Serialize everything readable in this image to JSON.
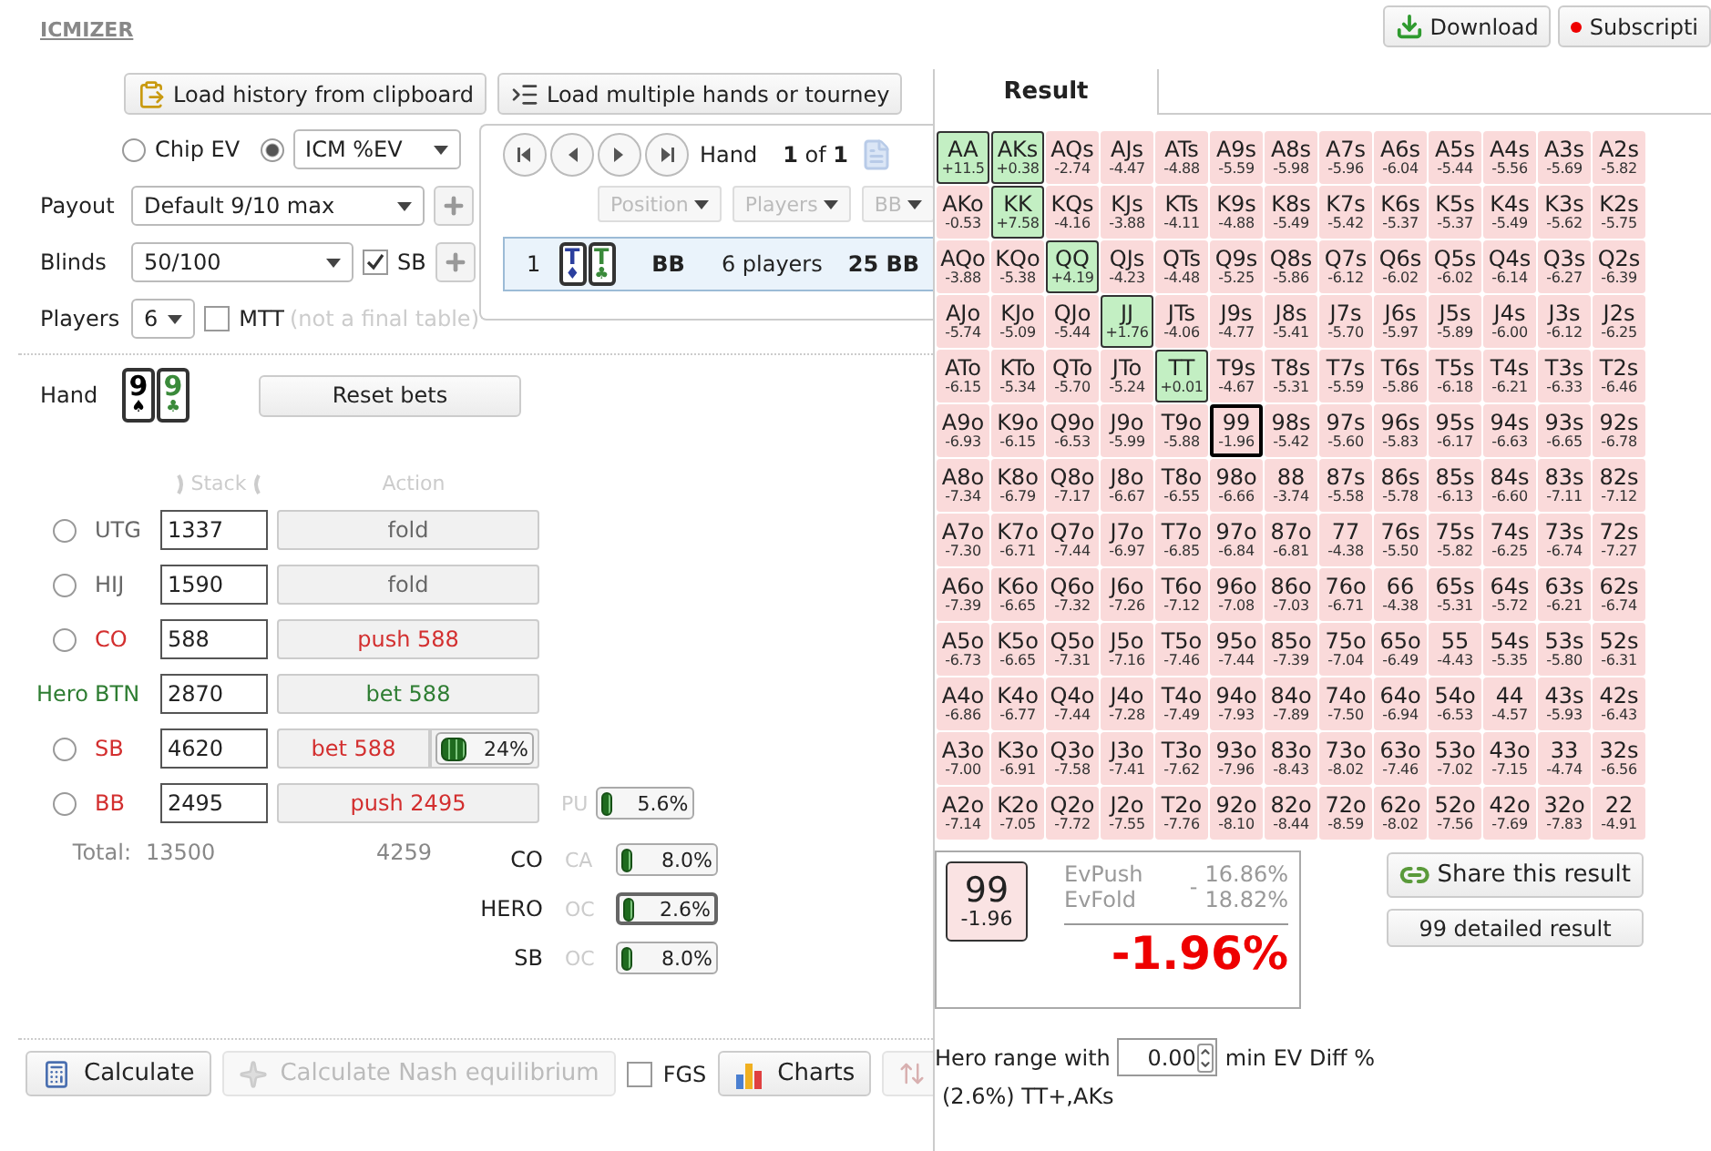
{
  "brand": "ICMIZER",
  "top_buttons": [
    {
      "label": "Download",
      "kind": "download"
    },
    {
      "label": "Subscripti",
      "kind": "subscription"
    }
  ],
  "load_buttons": [
    {
      "label": "Load history from clipboard",
      "kind": "clipboard"
    },
    {
      "label": "Load multiple hands or tourney",
      "kind": "list"
    }
  ],
  "mode": [
    {
      "label": "Chip EV",
      "selected": false,
      "kind": "plain"
    },
    {
      "label": "ICM %EV",
      "selected": true,
      "kind": "dropdown"
    }
  ],
  "payout": {
    "label": "Payout",
    "value": "Default 9/10 max"
  },
  "blinds": {
    "label": "Blinds",
    "value": "50/100",
    "checkbox": {
      "label": "SB",
      "checked": true
    }
  },
  "players": {
    "label": "Players",
    "value": "6",
    "checkbox": {
      "label": "MTT",
      "checked": false
    },
    "note": "(not a final table)"
  },
  "history": {
    "hand_label": "Hand",
    "counter": "**1** of **1**",
    "filters": [
      {
        "label": "Position",
        "disabled": true
      },
      {
        "label": "Players",
        "disabled": true
      },
      {
        "label": "BB",
        "disabled": true
      }
    ],
    "hands": [
      {
        "number": "1",
        "cards": [
          {
            "rank": "T",
            "suit": "♦",
            "color": "#2b3f9e"
          },
          {
            "rank": "T",
            "suit": "♣",
            "color": "#3a8a3a"
          }
        ],
        "position": "BB",
        "players": "6 players",
        "stack": "25 BB",
        "selected": true
      }
    ]
  },
  "hand": {
    "label": "Hand",
    "cards": [
      {
        "rank": "9",
        "suit": "♠",
        "color": "#000000"
      },
      {
        "rank": "9",
        "suit": "♣",
        "color": "#3a8a3a"
      }
    ],
    "reset_button": "Reset bets"
  },
  "table": {
    "columns": [
      "Stack",
      "Action"
    ],
    "rows": [
      {
        "kind": "villain",
        "position": "UTG",
        "selected": false,
        "color": "#666666",
        "stack": "1337",
        "action": "fold"
      },
      {
        "kind": "villain",
        "position": "HIJ",
        "selected": false,
        "color": "#666666",
        "stack": "1590",
        "action": "fold"
      },
      {
        "kind": "villain",
        "position": "CO",
        "selected": false,
        "color": "#d32f2f",
        "stack": "588",
        "action": "push 588"
      },
      {
        "kind": "hero",
        "hero_label": "Hero",
        "position": "BTN",
        "color": "#2e7d32",
        "stack": "2870",
        "action": "bet 588"
      },
      {
        "kind": "villain",
        "position": "SB",
        "selected": false,
        "color": "#d32f2f",
        "stack": "4620",
        "action": "bet 588",
        "share": {
          "text": "24%",
          "level": 0.24
        }
      },
      {
        "kind": "villain",
        "position": "BB",
        "selected": false,
        "color": "#d32f2f",
        "stack": "2495",
        "action": "push 2495",
        "range": {
          "code": "PU",
          "text": "5.6%",
          "level": 0.056
        }
      }
    ],
    "total": {
      "label": "Total:",
      "stack": "13500",
      "action": "4259"
    }
  },
  "ranges": [
    {
      "position": "CO",
      "code": "CA",
      "text": "8.0%",
      "level": 0.08,
      "selected": false
    },
    {
      "position": "HERO",
      "code": "OC",
      "text": "2.6%",
      "level": 0.026,
      "selected": true
    },
    {
      "position": "SB",
      "code": "OC",
      "text": "8.0%",
      "level": 0.08,
      "selected": false
    }
  ],
  "bottom_buttons": [
    {
      "kind": "calculator",
      "label": "Calculate",
      "disabled": false
    },
    {
      "kind": "nash",
      "label": "Calculate Nash equilibrium",
      "disabled": true
    },
    {
      "kind": "checkbox",
      "label": "FGS",
      "checked": false
    },
    {
      "kind": "charts",
      "label": "Charts",
      "disabled": false
    },
    {
      "kind": "sort",
      "disabled": true
    }
  ],
  "result": {
    "tabs": [
      {
        "label": "Result",
        "selected": true
      }
    ],
    "grid": {
      "rows": [
        [
          {
            "hand": "AA",
            "ev": "+11.5",
            "in_range": true,
            "selected": false
          },
          {
            "hand": "AKs",
            "ev": "+0.38",
            "in_range": true,
            "selected": false
          },
          {
            "hand": "AQs",
            "ev": "-2.74",
            "in_range": false,
            "selected": false
          },
          {
            "hand": "AJs",
            "ev": "-4.47",
            "in_range": false,
            "selected": false
          },
          {
            "hand": "ATs",
            "ev": "-4.88",
            "in_range": false,
            "selected": false
          },
          {
            "hand": "A9s",
            "ev": "-5.59",
            "in_range": false,
            "selected": false
          },
          {
            "hand": "A8s",
            "ev": "-5.98",
            "in_range": false,
            "selected": false
          },
          {
            "hand": "A7s",
            "ev": "-5.96",
            "in_range": false,
            "selected": false
          },
          {
            "hand": "A6s",
            "ev": "-6.04",
            "in_range": false,
            "selected": false
          },
          {
            "hand": "A5s",
            "ev": "-5.44",
            "in_range": false,
            "selected": false
          },
          {
            "hand": "A4s",
            "ev": "-5.56",
            "in_range": false,
            "selected": false
          },
          {
            "hand": "A3s",
            "ev": "-5.69",
            "in_range": false,
            "selected": false
          },
          {
            "hand": "A2s",
            "ev": "-5.82",
            "in_range": false,
            "selected": false
          }
        ],
        [
          {
            "hand": "AKo",
            "ev": "-0.53",
            "in_range": false,
            "selected": false
          },
          {
            "hand": "KK",
            "ev": "+7.58",
            "in_range": true,
            "selected": false
          },
          {
            "hand": "KQs",
            "ev": "-4.16",
            "in_range": false,
            "selected": false
          },
          {
            "hand": "KJs",
            "ev": "-3.88",
            "in_range": false,
            "selected": false
          },
          {
            "hand": "KTs",
            "ev": "-4.11",
            "in_range": false,
            "selected": false
          },
          {
            "hand": "K9s",
            "ev": "-4.88",
            "in_range": false,
            "selected": false
          },
          {
            "hand": "K8s",
            "ev": "-5.49",
            "in_range": false,
            "selected": false
          },
          {
            "hand": "K7s",
            "ev": "-5.42",
            "in_range": false,
            "selected": false
          },
          {
            "hand": "K6s",
            "ev": "-5.37",
            "in_range": false,
            "selected": false
          },
          {
            "hand": "K5s",
            "ev": "-5.37",
            "in_range": false,
            "selected": false
          },
          {
            "hand": "K4s",
            "ev": "-5.49",
            "in_range": false,
            "selected": false
          },
          {
            "hand": "K3s",
            "ev": "-5.62",
            "in_range": false,
            "selected": false
          },
          {
            "hand": "K2s",
            "ev": "-5.75",
            "in_range": false,
            "selected": false
          }
        ],
        [
          {
            "hand": "AQo",
            "ev": "-3.88",
            "in_range": false,
            "selected": false
          },
          {
            "hand": "KQo",
            "ev": "-5.38",
            "in_range": false,
            "selected": false
          },
          {
            "hand": "QQ",
            "ev": "+4.19",
            "in_range": true,
            "selected": false
          },
          {
            "hand": "QJs",
            "ev": "-4.23",
            "in_range": false,
            "selected": false
          },
          {
            "hand": "QTs",
            "ev": "-4.48",
            "in_range": false,
            "selected": false
          },
          {
            "hand": "Q9s",
            "ev": "-5.25",
            "in_range": false,
            "selected": false
          },
          {
            "hand": "Q8s",
            "ev": "-5.86",
            "in_range": false,
            "selected": false
          },
          {
            "hand": "Q7s",
            "ev": "-6.12",
            "in_range": false,
            "selected": false
          },
          {
            "hand": "Q6s",
            "ev": "-6.02",
            "in_range": false,
            "selected": false
          },
          {
            "hand": "Q5s",
            "ev": "-6.02",
            "in_range": false,
            "selected": false
          },
          {
            "hand": "Q4s",
            "ev": "-6.14",
            "in_range": false,
            "selected": false
          },
          {
            "hand": "Q3s",
            "ev": "-6.27",
            "in_range": false,
            "selected": false
          },
          {
            "hand": "Q2s",
            "ev": "-6.39",
            "in_range": false,
            "selected": false
          }
        ],
        [
          {
            "hand": "AJo",
            "ev": "-5.74",
            "in_range": false,
            "selected": false
          },
          {
            "hand": "KJo",
            "ev": "-5.09",
            "in_range": false,
            "selected": false
          },
          {
            "hand": "QJo",
            "ev": "-5.44",
            "in_range": false,
            "selected": false
          },
          {
            "hand": "JJ",
            "ev": "+1.76",
            "in_range": true,
            "selected": false
          },
          {
            "hand": "JTs",
            "ev": "-4.06",
            "in_range": false,
            "selected": false
          },
          {
            "hand": "J9s",
            "ev": "-4.77",
            "in_range": false,
            "selected": false
          },
          {
            "hand": "J8s",
            "ev": "-5.41",
            "in_range": false,
            "selected": false
          },
          {
            "hand": "J7s",
            "ev": "-5.70",
            "in_range": false,
            "selected": false
          },
          {
            "hand": "J6s",
            "ev": "-5.97",
            "in_range": false,
            "selected": false
          },
          {
            "hand": "J5s",
            "ev": "-5.89",
            "in_range": false,
            "selected": false
          },
          {
            "hand": "J4s",
            "ev": "-6.00",
            "in_range": false,
            "selected": false
          },
          {
            "hand": "J3s",
            "ev": "-6.12",
            "in_range": false,
            "selected": false
          },
          {
            "hand": "J2s",
            "ev": "-6.25",
            "in_range": false,
            "selected": false
          }
        ],
        [
          {
            "hand": "ATo",
            "ev": "-6.15",
            "in_range": false,
            "selected": false
          },
          {
            "hand": "KTo",
            "ev": "-5.34",
            "in_range": false,
            "selected": false
          },
          {
            "hand": "QTo",
            "ev": "-5.70",
            "in_range": false,
            "selected": false
          },
          {
            "hand": "JTo",
            "ev": "-5.24",
            "in_range": false,
            "selected": false
          },
          {
            "hand": "TT",
            "ev": "+0.01",
            "in_range": true,
            "selected": false
          },
          {
            "hand": "T9s",
            "ev": "-4.67",
            "in_range": false,
            "selected": false
          },
          {
            "hand": "T8s",
            "ev": "-5.31",
            "in_range": false,
            "selected": false
          },
          {
            "hand": "T7s",
            "ev": "-5.59",
            "in_range": false,
            "selected": false
          },
          {
            "hand": "T6s",
            "ev": "-5.86",
            "in_range": false,
            "selected": false
          },
          {
            "hand": "T5s",
            "ev": "-6.18",
            "in_range": false,
            "selected": false
          },
          {
            "hand": "T4s",
            "ev": "-6.21",
            "in_range": false,
            "selected": false
          },
          {
            "hand": "T3s",
            "ev": "-6.33",
            "in_range": false,
            "selected": false
          },
          {
            "hand": "T2s",
            "ev": "-6.46",
            "in_range": false,
            "selected": false
          }
        ],
        [
          {
            "hand": "A9o",
            "ev": "-6.93",
            "in_range": false,
            "selected": false
          },
          {
            "hand": "K9o",
            "ev": "-6.15",
            "in_range": false,
            "selected": false
          },
          {
            "hand": "Q9o",
            "ev": "-6.53",
            "in_range": false,
            "selected": false
          },
          {
            "hand": "J9o",
            "ev": "-5.99",
            "in_range": false,
            "selected": false
          },
          {
            "hand": "T9o",
            "ev": "-5.88",
            "in_range": false,
            "selected": false
          },
          {
            "hand": "99",
            "ev": "-1.96",
            "in_range": false,
            "selected": true
          },
          {
            "hand": "98s",
            "ev": "-5.42",
            "in_range": false,
            "selected": false
          },
          {
            "hand": "97s",
            "ev": "-5.60",
            "in_range": false,
            "selected": false
          },
          {
            "hand": "96s",
            "ev": "-5.83",
            "in_range": false,
            "selected": false
          },
          {
            "hand": "95s",
            "ev": "-6.17",
            "in_range": false,
            "selected": false
          },
          {
            "hand": "94s",
            "ev": "-6.63",
            "in_range": false,
            "selected": false
          },
          {
            "hand": "93s",
            "ev": "-6.65",
            "in_range": false,
            "selected": false
          },
          {
            "hand": "92s",
            "ev": "-6.78",
            "in_range": false,
            "selected": false
          }
        ],
        [
          {
            "hand": "A8o",
            "ev": "-7.34",
            "in_range": false,
            "selected": false
          },
          {
            "hand": "K8o",
            "ev": "-6.79",
            "in_range": false,
            "selected": false
          },
          {
            "hand": "Q8o",
            "ev": "-7.17",
            "in_range": false,
            "selected": false
          },
          {
            "hand": "J8o",
            "ev": "-6.67",
            "in_range": false,
            "selected": false
          },
          {
            "hand": "T8o",
            "ev": "-6.55",
            "in_range": false,
            "selected": false
          },
          {
            "hand": "98o",
            "ev": "-6.66",
            "in_range": false,
            "selected": false
          },
          {
            "hand": "88",
            "ev": "-3.74",
            "in_range": false,
            "selected": false
          },
          {
            "hand": "87s",
            "ev": "-5.58",
            "in_range": false,
            "selected": false
          },
          {
            "hand": "86s",
            "ev": "-5.78",
            "in_range": false,
            "selected": false
          },
          {
            "hand": "85s",
            "ev": "-6.13",
            "in_range": false,
            "selected": false
          },
          {
            "hand": "84s",
            "ev": "-6.60",
            "in_range": false,
            "selected": false
          },
          {
            "hand": "83s",
            "ev": "-7.11",
            "in_range": false,
            "selected": false
          },
          {
            "hand": "82s",
            "ev": "-7.12",
            "in_range": false,
            "selected": false
          }
        ],
        [
          {
            "hand": "A7o",
            "ev": "-7.30",
            "in_range": false,
            "selected": false
          },
          {
            "hand": "K7o",
            "ev": "-6.71",
            "in_range": false,
            "selected": false
          },
          {
            "hand": "Q7o",
            "ev": "-7.44",
            "in_range": false,
            "selected": false
          },
          {
            "hand": "J7o",
            "ev": "-6.97",
            "in_range": false,
            "selected": false
          },
          {
            "hand": "T7o",
            "ev": "-6.85",
            "in_range": false,
            "selected": false
          },
          {
            "hand": "97o",
            "ev": "-6.84",
            "in_range": false,
            "selected": false
          },
          {
            "hand": "87o",
            "ev": "-6.81",
            "in_range": false,
            "selected": false
          },
          {
            "hand": "77",
            "ev": "-4.38",
            "in_range": false,
            "selected": false
          },
          {
            "hand": "76s",
            "ev": "-5.50",
            "in_range": false,
            "selected": false
          },
          {
            "hand": "75s",
            "ev": "-5.82",
            "in_range": false,
            "selected": false
          },
          {
            "hand": "74s",
            "ev": "-6.25",
            "in_range": false,
            "selected": false
          },
          {
            "hand": "73s",
            "ev": "-6.74",
            "in_range": false,
            "selected": false
          },
          {
            "hand": "72s",
            "ev": "-7.27",
            "in_range": false,
            "selected": false
          }
        ],
        [
          {
            "hand": "A6o",
            "ev": "-7.39",
            "in_range": false,
            "selected": false
          },
          {
            "hand": "K6o",
            "ev": "-6.65",
            "in_range": false,
            "selected": false
          },
          {
            "hand": "Q6o",
            "ev": "-7.32",
            "in_range": false,
            "selected": false
          },
          {
            "hand": "J6o",
            "ev": "-7.26",
            "in_range": false,
            "selected": false
          },
          {
            "hand": "T6o",
            "ev": "-7.12",
            "in_range": false,
            "selected": false
          },
          {
            "hand": "96o",
            "ev": "-7.08",
            "in_range": false,
            "selected": false
          },
          {
            "hand": "86o",
            "ev": "-7.03",
            "in_range": false,
            "selected": false
          },
          {
            "hand": "76o",
            "ev": "-6.71",
            "in_range": false,
            "selected": false
          },
          {
            "hand": "66",
            "ev": "-4.38",
            "in_range": false,
            "selected": false
          },
          {
            "hand": "65s",
            "ev": "-5.31",
            "in_range": false,
            "selected": false
          },
          {
            "hand": "64s",
            "ev": "-5.72",
            "in_range": false,
            "selected": false
          },
          {
            "hand": "63s",
            "ev": "-6.21",
            "in_range": false,
            "selected": false
          },
          {
            "hand": "62s",
            "ev": "-6.74",
            "in_range": false,
            "selected": false
          }
        ],
        [
          {
            "hand": "A5o",
            "ev": "-6.73",
            "in_range": false,
            "selected": false
          },
          {
            "hand": "K5o",
            "ev": "-6.65",
            "in_range": false,
            "selected": false
          },
          {
            "hand": "Q5o",
            "ev": "-7.31",
            "in_range": false,
            "selected": false
          },
          {
            "hand": "J5o",
            "ev": "-7.16",
            "in_range": false,
            "selected": false
          },
          {
            "hand": "T5o",
            "ev": "-7.46",
            "in_range": false,
            "selected": false
          },
          {
            "hand": "95o",
            "ev": "-7.44",
            "in_range": false,
            "selected": false
          },
          {
            "hand": "85o",
            "ev": "-7.39",
            "in_range": false,
            "selected": false
          },
          {
            "hand": "75o",
            "ev": "-7.04",
            "in_range": false,
            "selected": false
          },
          {
            "hand": "65o",
            "ev": "-6.49",
            "in_range": false,
            "selected": false
          },
          {
            "hand": "55",
            "ev": "-4.43",
            "in_range": false,
            "selected": false
          },
          {
            "hand": "54s",
            "ev": "-5.35",
            "in_range": false,
            "selected": false
          },
          {
            "hand": "53s",
            "ev": "-5.80",
            "in_range": false,
            "selected": false
          },
          {
            "hand": "52s",
            "ev": "-6.31",
            "in_range": false,
            "selected": false
          }
        ],
        [
          {
            "hand": "A4o",
            "ev": "-6.86",
            "in_range": false,
            "selected": false
          },
          {
            "hand": "K4o",
            "ev": "-6.77",
            "in_range": false,
            "selected": false
          },
          {
            "hand": "Q4o",
            "ev": "-7.44",
            "in_range": false,
            "selected": false
          },
          {
            "hand": "J4o",
            "ev": "-7.28",
            "in_range": false,
            "selected": false
          },
          {
            "hand": "T4o",
            "ev": "-7.49",
            "in_range": false,
            "selected": false
          },
          {
            "hand": "94o",
            "ev": "-7.93",
            "in_range": false,
            "selected": false
          },
          {
            "hand": "84o",
            "ev": "-7.89",
            "in_range": false,
            "selected": false
          },
          {
            "hand": "74o",
            "ev": "-7.50",
            "in_range": false,
            "selected": false
          },
          {
            "hand": "64o",
            "ev": "-6.94",
            "in_range": false,
            "selected": false
          },
          {
            "hand": "54o",
            "ev": "-6.53",
            "in_range": false,
            "selected": false
          },
          {
            "hand": "44",
            "ev": "-4.57",
            "in_range": false,
            "selected": false
          },
          {
            "hand": "43s",
            "ev": "-5.93",
            "in_range": false,
            "selected": false
          },
          {
            "hand": "42s",
            "ev": "-6.43",
            "in_range": false,
            "selected": false
          }
        ],
        [
          {
            "hand": "A3o",
            "ev": "-7.00",
            "in_range": false,
            "selected": false
          },
          {
            "hand": "K3o",
            "ev": "-6.91",
            "in_range": false,
            "selected": false
          },
          {
            "hand": "Q3o",
            "ev": "-7.58",
            "in_range": false,
            "selected": false
          },
          {
            "hand": "J3o",
            "ev": "-7.41",
            "in_range": false,
            "selected": false
          },
          {
            "hand": "T3o",
            "ev": "-7.62",
            "in_range": false,
            "selected": false
          },
          {
            "hand": "93o",
            "ev": "-7.96",
            "in_range": false,
            "selected": false
          },
          {
            "hand": "83o",
            "ev": "-8.43",
            "in_range": false,
            "selected": false
          },
          {
            "hand": "73o",
            "ev": "-8.02",
            "in_range": false,
            "selected": false
          },
          {
            "hand": "63o",
            "ev": "-7.46",
            "in_range": false,
            "selected": false
          },
          {
            "hand": "53o",
            "ev": "-7.02",
            "in_range": false,
            "selected": false
          },
          {
            "hand": "43o",
            "ev": "-7.15",
            "in_range": false,
            "selected": false
          },
          {
            "hand": "33",
            "ev": "-4.74",
            "in_range": false,
            "selected": false
          },
          {
            "hand": "32s",
            "ev": "-6.56",
            "in_range": false,
            "selected": false
          }
        ],
        [
          {
            "hand": "A2o",
            "ev": "-7.14",
            "in_range": false,
            "selected": false
          },
          {
            "hand": "K2o",
            "ev": "-7.05",
            "in_range": false,
            "selected": false
          },
          {
            "hand": "Q2o",
            "ev": "-7.72",
            "in_range": false,
            "selected": false
          },
          {
            "hand": "J2o",
            "ev": "-7.55",
            "in_range": false,
            "selected": false
          },
          {
            "hand": "T2o",
            "ev": "-7.76",
            "in_range": false,
            "selected": false
          },
          {
            "hand": "92o",
            "ev": "-8.10",
            "in_range": false,
            "selected": false
          },
          {
            "hand": "82o",
            "ev": "-8.44",
            "in_range": false,
            "selected": false
          },
          {
            "hand": "72o",
            "ev": "-8.59",
            "in_range": false,
            "selected": false
          },
          {
            "hand": "62o",
            "ev": "-8.02",
            "in_range": false,
            "selected": false
          },
          {
            "hand": "52o",
            "ev": "-7.56",
            "in_range": false,
            "selected": false
          },
          {
            "hand": "42o",
            "ev": "-7.69",
            "in_range": false,
            "selected": false
          },
          {
            "hand": "32o",
            "ev": "-7.83",
            "in_range": false,
            "selected": false
          },
          {
            "hand": "22",
            "ev": "-4.91",
            "in_range": false,
            "selected": false
          }
        ]
      ]
    },
    "summary": {
      "cell": {
        "hand": "99",
        "ev": "-1.96"
      },
      "rows": [
        {
          "label": "EvPush",
          "value": "16.86%"
        },
        {
          "label": "EvFold",
          "value": "18.82%"
        }
      ],
      "sign": "-",
      "total": "-1.96%"
    },
    "share_button": "Share this result",
    "detail_button": "99 detailed result",
    "range": {
      "label": "Hero range with",
      "value": "0.00",
      "suffix": "min EV Diff %",
      "text": "(2.6%) TT+,AKs"
    }
  }
}
